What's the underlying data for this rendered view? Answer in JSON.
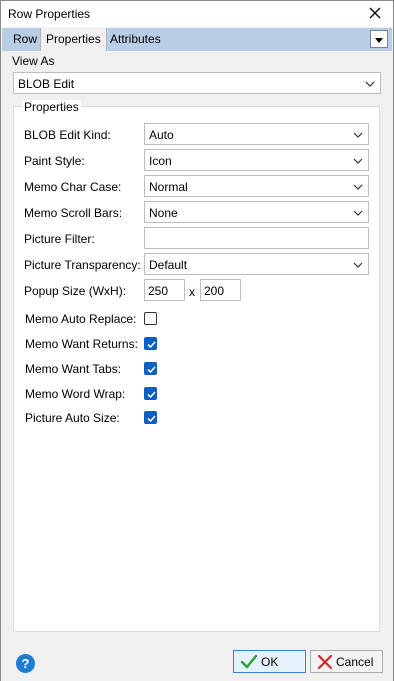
{
  "window": {
    "title": "Row Properties"
  },
  "tabs": [
    {
      "label": "Row"
    },
    {
      "label": "Properties"
    },
    {
      "label": "Attributes"
    }
  ],
  "view_as": {
    "label": "View As",
    "value": "BLOB Edit"
  },
  "group": {
    "title": "Properties"
  },
  "fields": {
    "blob_edit_kind": {
      "label": "BLOB Edit Kind:",
      "value": "Auto"
    },
    "paint_style": {
      "label": "Paint Style:",
      "value": "Icon"
    },
    "memo_char_case": {
      "label": "Memo Char Case:",
      "value": "Normal"
    },
    "memo_scroll_bars": {
      "label": "Memo Scroll Bars:",
      "value": "None"
    },
    "picture_filter": {
      "label": "Picture Filter:",
      "value": ""
    },
    "picture_transparency": {
      "label": "Picture Transparency:",
      "value": "Default"
    },
    "popup_size": {
      "label": "Popup Size (WxH):",
      "width": "250",
      "sep": "x",
      "height": "200"
    }
  },
  "checkboxes": {
    "memo_auto_replace": {
      "label": "Memo Auto Replace:",
      "checked": false
    },
    "memo_want_returns": {
      "label": "Memo Want Returns:",
      "checked": true
    },
    "memo_want_tabs": {
      "label": "Memo Want Tabs:",
      "checked": true
    },
    "memo_word_wrap": {
      "label": "Memo Word Wrap:",
      "checked": true
    },
    "picture_auto_size": {
      "label": "Picture Auto Size:",
      "checked": true
    }
  },
  "buttons": {
    "ok": "OK",
    "cancel": "Cancel",
    "help": "?"
  },
  "colors": {
    "accent": "#0a5fc6",
    "tabbar": "#b9cde5",
    "ok_check": "#2e9e3a",
    "cancel_x": "#d62828"
  }
}
